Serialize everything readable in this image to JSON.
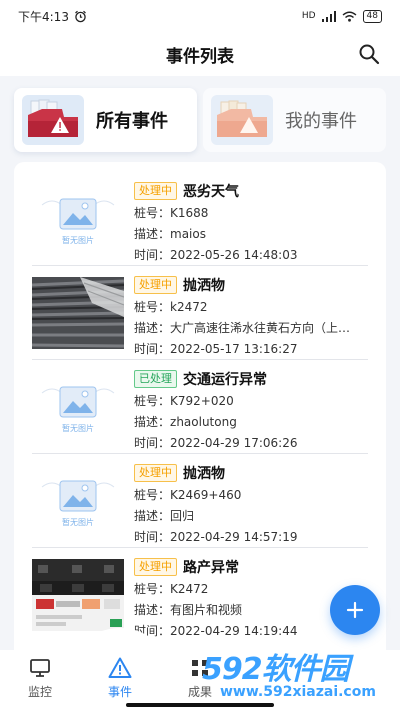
{
  "status_bar": {
    "time": "下午4:13",
    "battery": "48",
    "signal_label": "HD"
  },
  "header": {
    "title": "事件列表"
  },
  "tabs": [
    {
      "label": "所有事件",
      "active": true
    },
    {
      "label": "我的事件",
      "active": false
    }
  ],
  "events": [
    {
      "status": "处理中",
      "title": "恶劣天气",
      "pile_label": "桩号：",
      "pile": "K1688",
      "desc_label": "描述：",
      "desc": "maios",
      "time_label": "时间：",
      "time": "2022-05-26 14:48:03",
      "thumb": "placeholder"
    },
    {
      "status": "处理中",
      "title": "抛洒物",
      "pile_label": "桩号：",
      "pile": "k2472",
      "desc_label": "描述：",
      "desc": "大广高速往浠水往黄石方向（上…",
      "time_label": "时间：",
      "time": "2022-05-17 13:16:27",
      "thumb": "photo"
    },
    {
      "status": "已处理",
      "title": "交通运行异常",
      "pile_label": "桩号：",
      "pile": "K792+020",
      "desc_label": "描述：",
      "desc": "zhaolutong",
      "time_label": "时间：",
      "time": "2022-04-29 17:06:26",
      "thumb": "placeholder"
    },
    {
      "status": "处理中",
      "title": "抛洒物",
      "pile_label": "桩号：",
      "pile": "K2469+460",
      "desc_label": "描述：",
      "desc": "回归",
      "time_label": "时间：",
      "time": "2022-04-29 14:57:19",
      "thumb": "placeholder"
    },
    {
      "status": "处理中",
      "title": "路产异常",
      "pile_label": "桩号：",
      "pile": "K2472",
      "desc_label": "描述：",
      "desc": "有图片和视频",
      "time_label": "时间：",
      "time": "2022-04-29 14:19:44",
      "thumb": "screenshot"
    }
  ],
  "placeholder_thumb_text": "暂无图片",
  "fab": {
    "icon": "plus-icon"
  },
  "bottom_nav": [
    {
      "label": "监控",
      "icon": "monitor-icon",
      "active": false
    },
    {
      "label": "事件",
      "icon": "warning-icon",
      "active": true
    },
    {
      "label": "成果",
      "icon": "grid-icon",
      "active": false
    }
  ],
  "watermark": {
    "brand": "592软件园",
    "url": "www.592xiazai.com"
  },
  "colors": {
    "accent": "#2c86f0",
    "pending": "#f5a000",
    "done": "#26a65b",
    "background": "#f3f5f9"
  }
}
